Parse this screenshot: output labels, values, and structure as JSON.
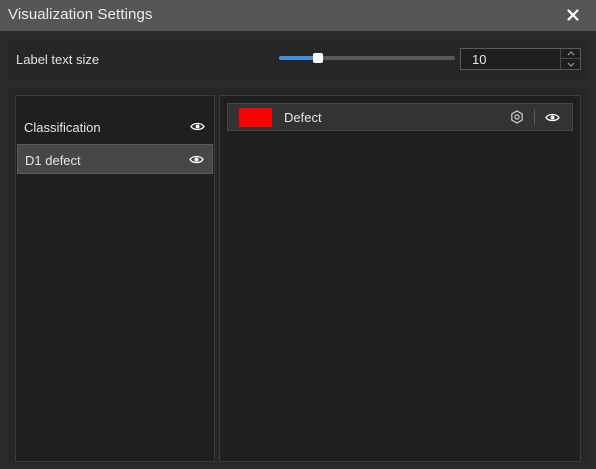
{
  "window": {
    "title": "Visualization Settings",
    "close_icon": "close-icon"
  },
  "label_size": {
    "label": "Label text size",
    "value": "10",
    "slider_fraction": 0.22
  },
  "classes": [
    {
      "label": "Classification",
      "visible": true,
      "selected": false,
      "icon": "eye-icon"
    },
    {
      "label": "D1 defect",
      "visible": true,
      "selected": true,
      "icon": "eye-icon"
    }
  ],
  "defects": [
    {
      "label": "Defect",
      "color": "#ff0000",
      "settings_icon": "hexagon-settings-icon",
      "visibility_icon": "eye-icon"
    }
  ],
  "colors": {
    "accent": "#3d8fe6",
    "titlebar": "#565656"
  }
}
